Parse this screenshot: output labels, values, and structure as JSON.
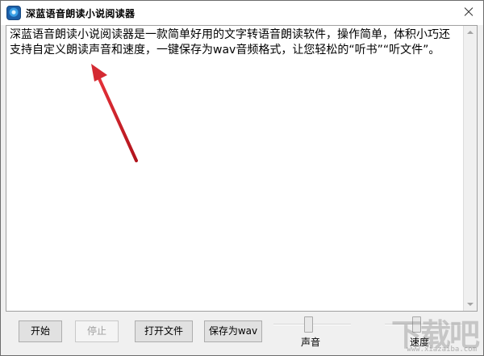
{
  "window": {
    "title": "深蓝语音朗读小说阅读器"
  },
  "editor": {
    "content": "深蓝语音朗读小说阅读器是一款简单好用的文字转语音朗读软件，操作简单，体积小巧还支持自定义朗读声音和速度，一键保存为wav音频格式，让您轻松的“听书”“听文件”。"
  },
  "toolbar": {
    "start_label": "开始",
    "stop_label": "停止",
    "open_file_label": "打开文件",
    "save_wav_label": "保存为wav",
    "volume_label": "声音",
    "speed_label": "速度"
  },
  "sliders": {
    "volume_level": 0.45,
    "speed_level": 0.4
  },
  "watermark": {
    "main": "下载吧",
    "sub": "www.xiazaiba.com"
  },
  "colors": {
    "arrow": "#c8202a",
    "window_bg": "#f0f0f0",
    "button_bg": "#e1e1e1"
  }
}
